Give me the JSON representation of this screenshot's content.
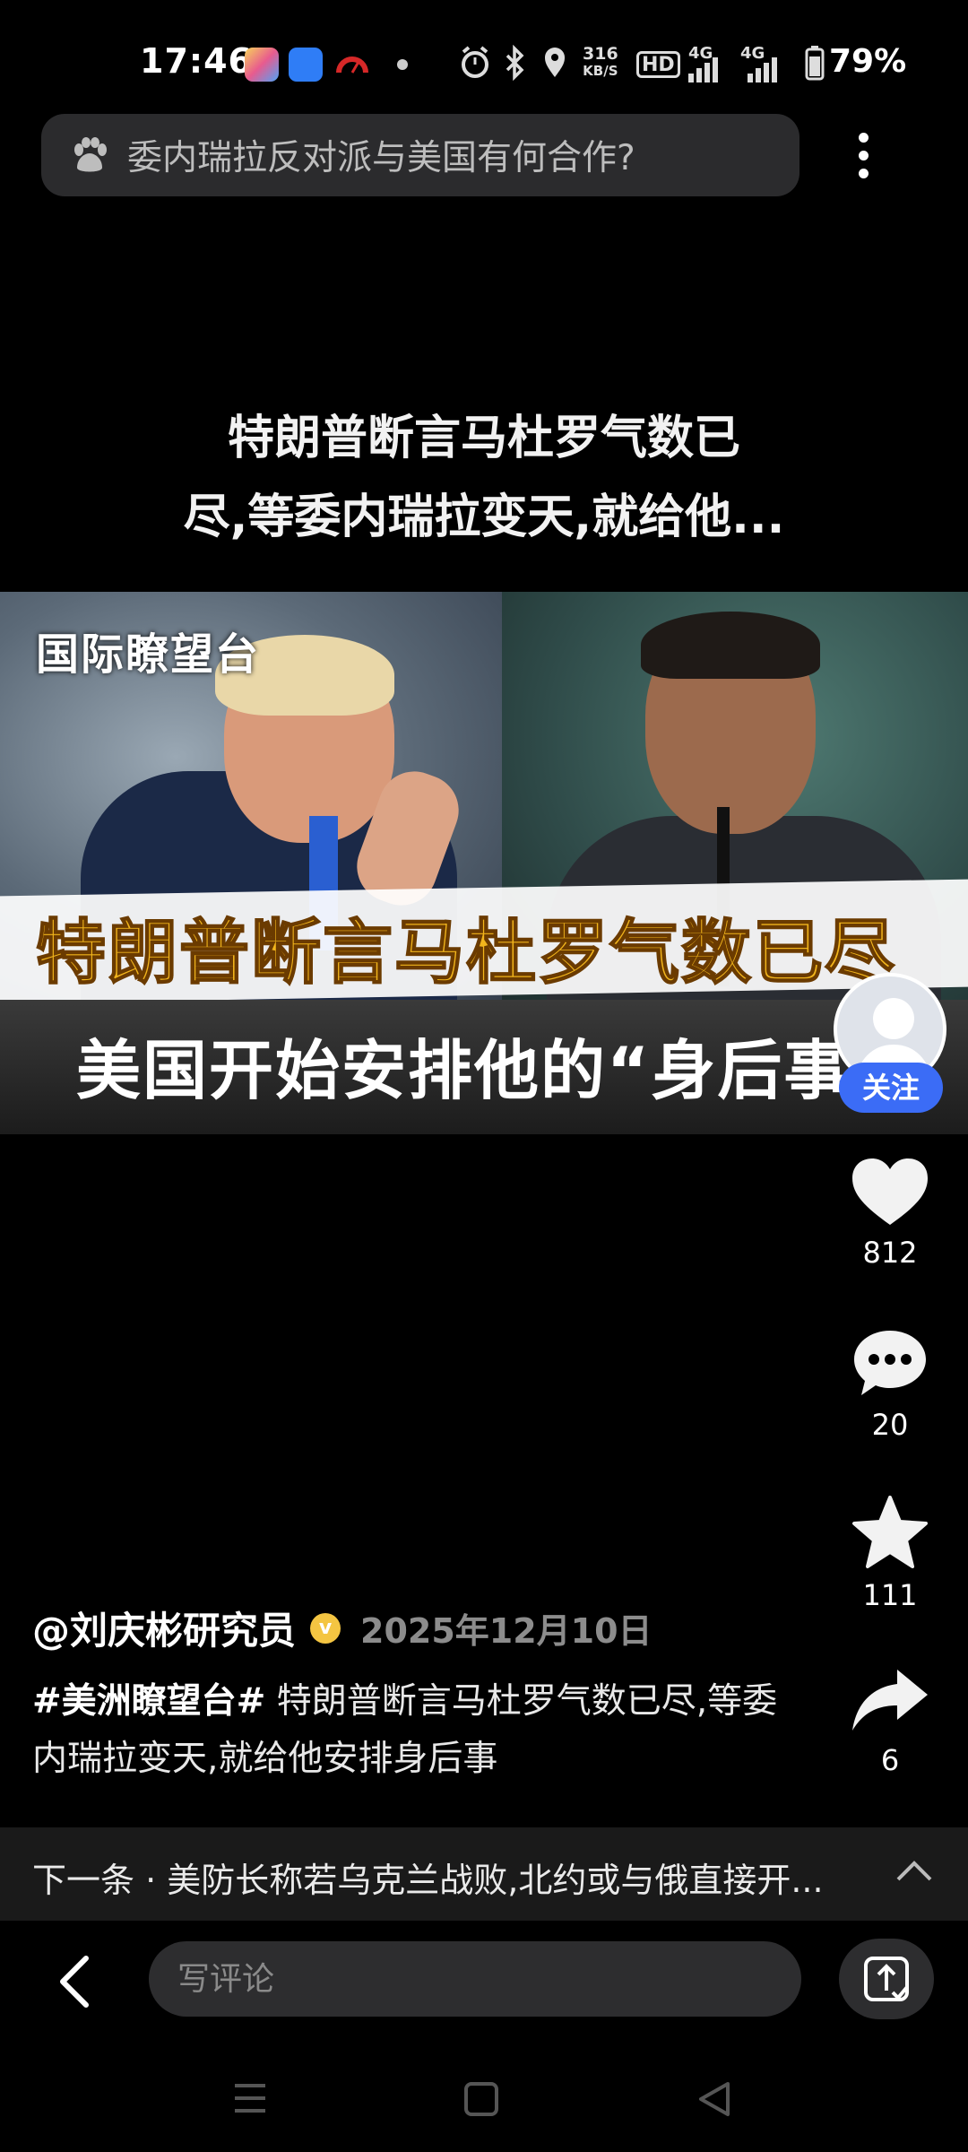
{
  "status_bar": {
    "time": "17:46",
    "net_speed_top": "316",
    "net_speed_bottom": "KB/S",
    "hd_label": "HD",
    "signal1": "4G",
    "signal2": "4G",
    "battery_percent": "79%"
  },
  "search": {
    "query": "委内瑞拉反对派与美国有何合作?"
  },
  "video": {
    "title_line1": "特朗普断言马杜罗气数已",
    "title_line2": "尽,等委内瑞拉变天,就给他...",
    "thumbnail": {
      "logo_text": "国际瞭望台",
      "headline": "特朗普断言马杜罗气数已尽",
      "subheadline": "美国开始安排他的“身后事"
    }
  },
  "actions": {
    "follow_label": "关注",
    "like_count": "812",
    "comment_count": "20",
    "favorite_count": "111",
    "share_count": "6"
  },
  "author": {
    "name": "@刘庆彬研究员",
    "verified_mark": "v",
    "date": "2025年12月10日"
  },
  "description": {
    "hashtag": "#美洲瞭望台#",
    "text": " 特朗普断言马杜罗气数已尽,等委内瑞拉变天,就给他安排身后事"
  },
  "next_up": {
    "text": "下一条 · 美防长称若乌克兰战败,北约或与俄直接开..."
  },
  "comment": {
    "placeholder": "写评论"
  },
  "colors": {
    "background": "#000000",
    "follow_button": "#3b6cf6",
    "search_bg": "#2b2b2d",
    "thumbnail_headline": "#f2b51c"
  }
}
